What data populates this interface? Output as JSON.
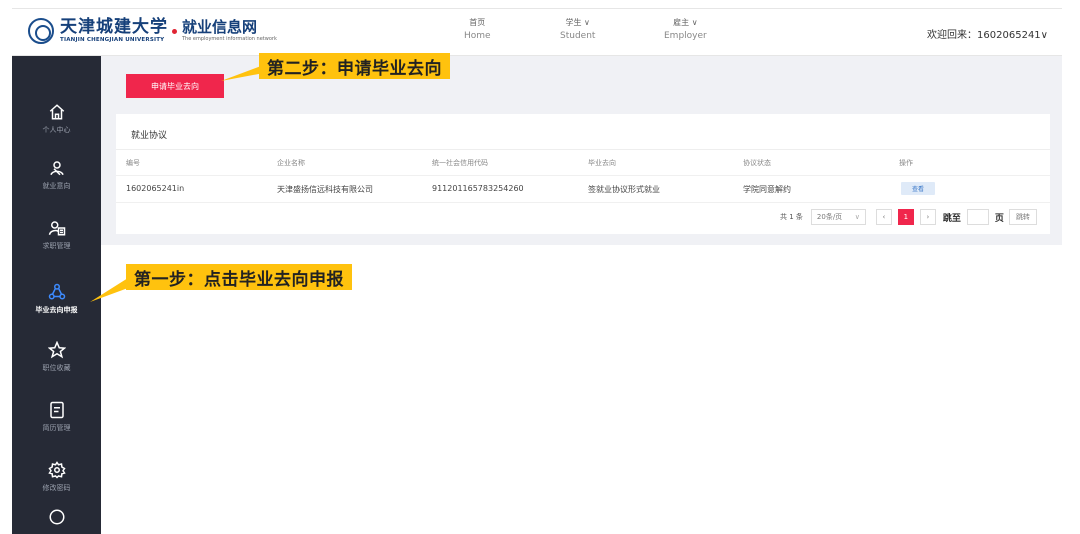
{
  "header": {
    "university_cn": "天津城建大学",
    "university_en": "TIANJIN CHENGJIAN UNIVERSITY",
    "site_cn": "就业信息网",
    "site_en": "The employment information network",
    "nav": [
      {
        "cn": "首页",
        "en": "Home"
      },
      {
        "cn": "学生 ∨",
        "en": "Student"
      },
      {
        "cn": "雇主 ∨",
        "en": "Employer"
      }
    ],
    "welcome": "欢迎回来：1602065241∨"
  },
  "sidebar": {
    "items": [
      {
        "label": "个人中心",
        "icon": "home-icon"
      },
      {
        "label": "就业意向",
        "icon": "intent-icon"
      },
      {
        "label": "求职管理",
        "icon": "job-manage-icon"
      },
      {
        "label": "毕业去向申报",
        "icon": "destination-icon"
      },
      {
        "label": "职位收藏",
        "icon": "star-icon"
      },
      {
        "label": "简历管理",
        "icon": "resume-icon"
      },
      {
        "label": "修改密码",
        "icon": "gear-icon"
      }
    ]
  },
  "main": {
    "apply_button": "申请毕业去向",
    "card_title": "就业协议",
    "columns": [
      "编号",
      "企业名称",
      "统一社会信用代码",
      "毕业去向",
      "协议状态",
      "操作"
    ],
    "row": {
      "id": "1602065241in",
      "company": "天津盛扬信远科技有限公司",
      "credit_code": "911201165783254260",
      "destination": "签就业协议形式就业",
      "status": "学院同意解约",
      "action": "查看"
    },
    "pager": {
      "total": "共 1 条",
      "page_size": "20条/页",
      "prev": "‹",
      "page": "1",
      "next": "›",
      "goto": "跳至",
      "unit": "页",
      "jump": "跳转"
    }
  },
  "callouts": {
    "step2": "第二步：申请毕业去向",
    "step1": "第一步：点击毕业去向申报"
  },
  "colors": {
    "accent": "#f0264c",
    "sidebar": "#262a36",
    "callout": "#ffc20e"
  }
}
